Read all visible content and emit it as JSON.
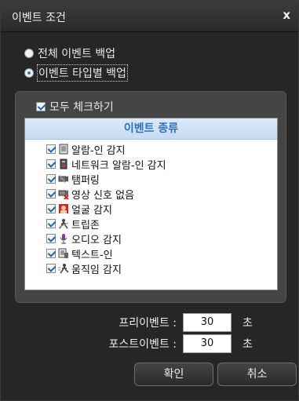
{
  "dialog": {
    "title": "이벤트 조건",
    "close_glyph": "x"
  },
  "options": {
    "all_backup": "전체 이벤트 백업",
    "by_type_backup": "이벤트 타입별 백업",
    "selected": "by_type_backup"
  },
  "panel": {
    "check_all_label": "모두 체크하기",
    "check_all_checked": true,
    "header": "이벤트 종류",
    "items": [
      {
        "label": "알람-인 감지",
        "icon": "alarm-in-icon",
        "checked": true
      },
      {
        "label": "네트워크 알람-인 감지",
        "icon": "network-alarm-icon",
        "checked": true
      },
      {
        "label": "탬퍼링",
        "icon": "tampering-camera-icon",
        "checked": true
      },
      {
        "label": "영상 신호 없음",
        "icon": "video-loss-icon",
        "checked": true
      },
      {
        "label": "얼굴 감지",
        "icon": "face-detect-icon",
        "checked": true
      },
      {
        "label": "트립존",
        "icon": "tripzone-icon",
        "checked": true
      },
      {
        "label": "오디오 감지",
        "icon": "microphone-icon",
        "checked": true
      },
      {
        "label": "텍스트-인",
        "icon": "text-in-icon",
        "checked": true
      },
      {
        "label": "움직임 감지",
        "icon": "motion-detect-icon",
        "checked": true
      }
    ]
  },
  "pre_event": {
    "label": "프리이벤트 :",
    "value": "30",
    "unit": "초"
  },
  "post_event": {
    "label": "포스트이벤트 :",
    "value": "30",
    "unit": "초"
  },
  "buttons": {
    "ok": "확인",
    "cancel": "취소"
  }
}
